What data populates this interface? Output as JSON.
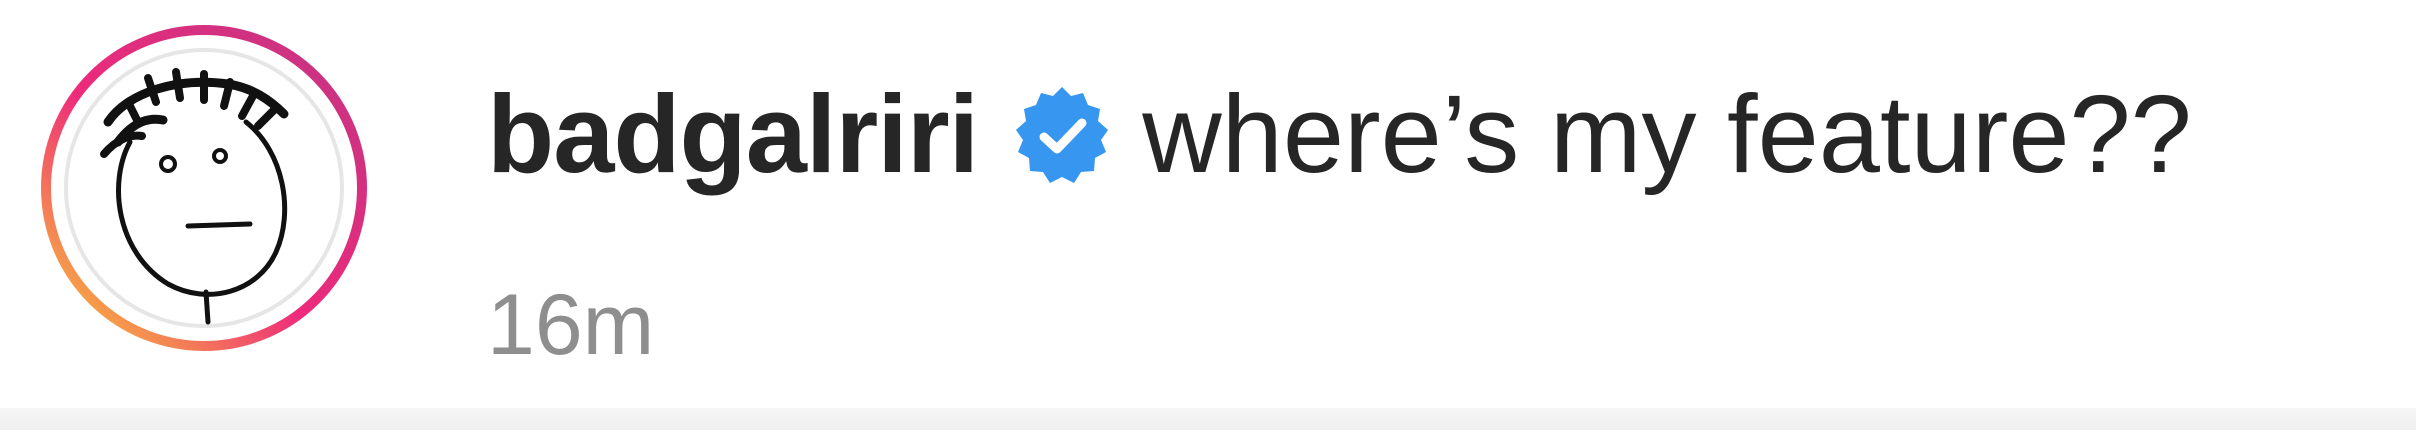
{
  "comment": {
    "username": "badgalriri",
    "text": "where’s my feature??",
    "timestamp": "16m",
    "verified": true
  },
  "icons": {
    "avatar": "avatar-face-drawing",
    "badge": "verified-badge-icon"
  },
  "colors": {
    "username": "#262626",
    "text": "#262626",
    "timestamp": "#8e8e8e",
    "verified_badge": "#3797f0",
    "story_ring_start": "#f9ce34",
    "story_ring_mid": "#ee2a7b",
    "story_ring_end": "#c13584"
  }
}
